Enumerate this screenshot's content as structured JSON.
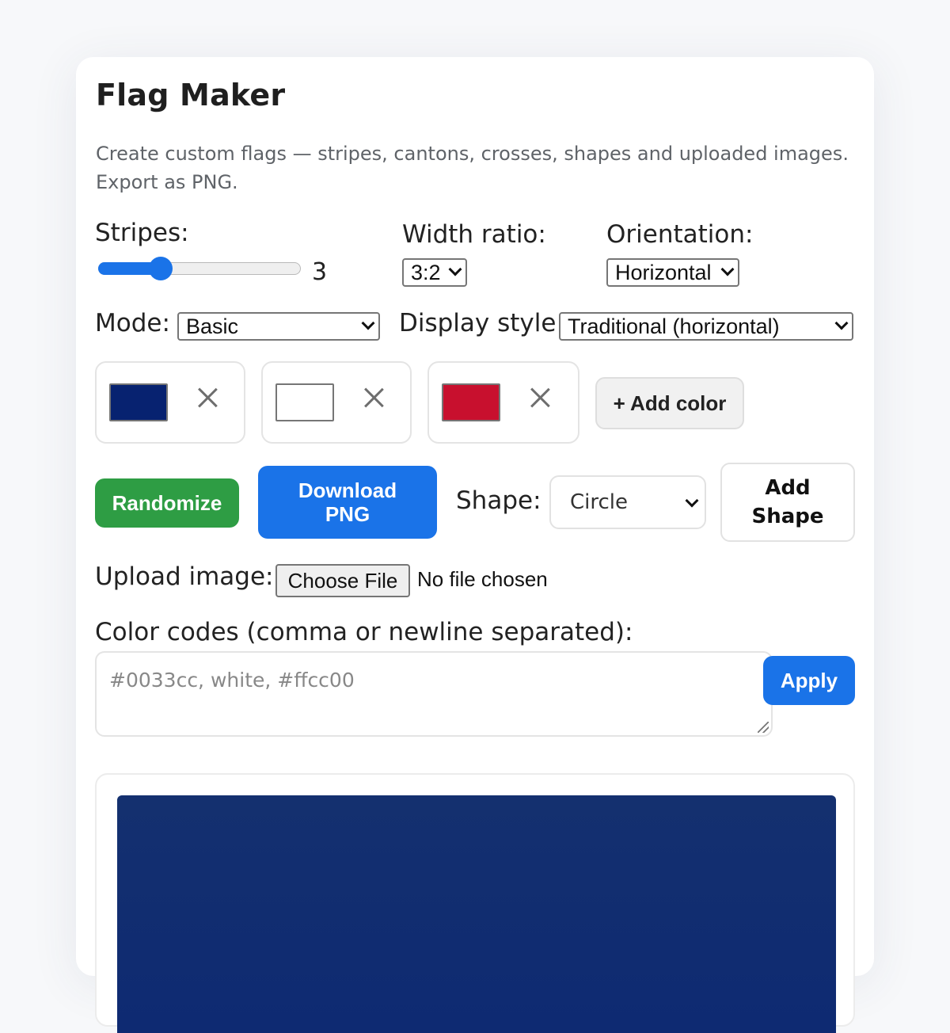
{
  "app": {
    "title": "Flag Maker",
    "subtitle": "Create custom flags — stripes, cantons, crosses, shapes and uploaded images. Export as PNG."
  },
  "controls": {
    "stripes_label": "Stripes:",
    "stripes_value": 3,
    "stripes_display": "3",
    "stripes_fraction": 0.31,
    "width_ratio_label": "Width ratio:",
    "width_ratio_value": "3:2",
    "orientation_label": "Orientation:",
    "orientation_value": "Horizontal",
    "mode_label": "Mode:",
    "mode_value": "Basic",
    "display_style_label": "Display style:",
    "display_style_value": "Traditional (horizontal)"
  },
  "colors": [
    {
      "hex": "#072270"
    },
    {
      "hex": "#ffffff"
    },
    {
      "hex": "#c8102e"
    }
  ],
  "buttons": {
    "add_color": "+ Add color",
    "randomize": "Randomize",
    "download": "Download PNG",
    "add_shape": "Add Shape",
    "apply": "Apply"
  },
  "shape": {
    "label": "Shape:",
    "value": "Circle"
  },
  "upload": {
    "label": "Upload image:",
    "button": "Choose File",
    "status": "No file chosen"
  },
  "codes": {
    "label": "Color codes (comma or newline separated):",
    "placeholder": "#0033cc, white, #ffcc00"
  },
  "preview": {
    "top_stripe_color": "#0e2a72"
  },
  "theme": {
    "accent": "#1a73e8",
    "success": "#2e9d44"
  }
}
